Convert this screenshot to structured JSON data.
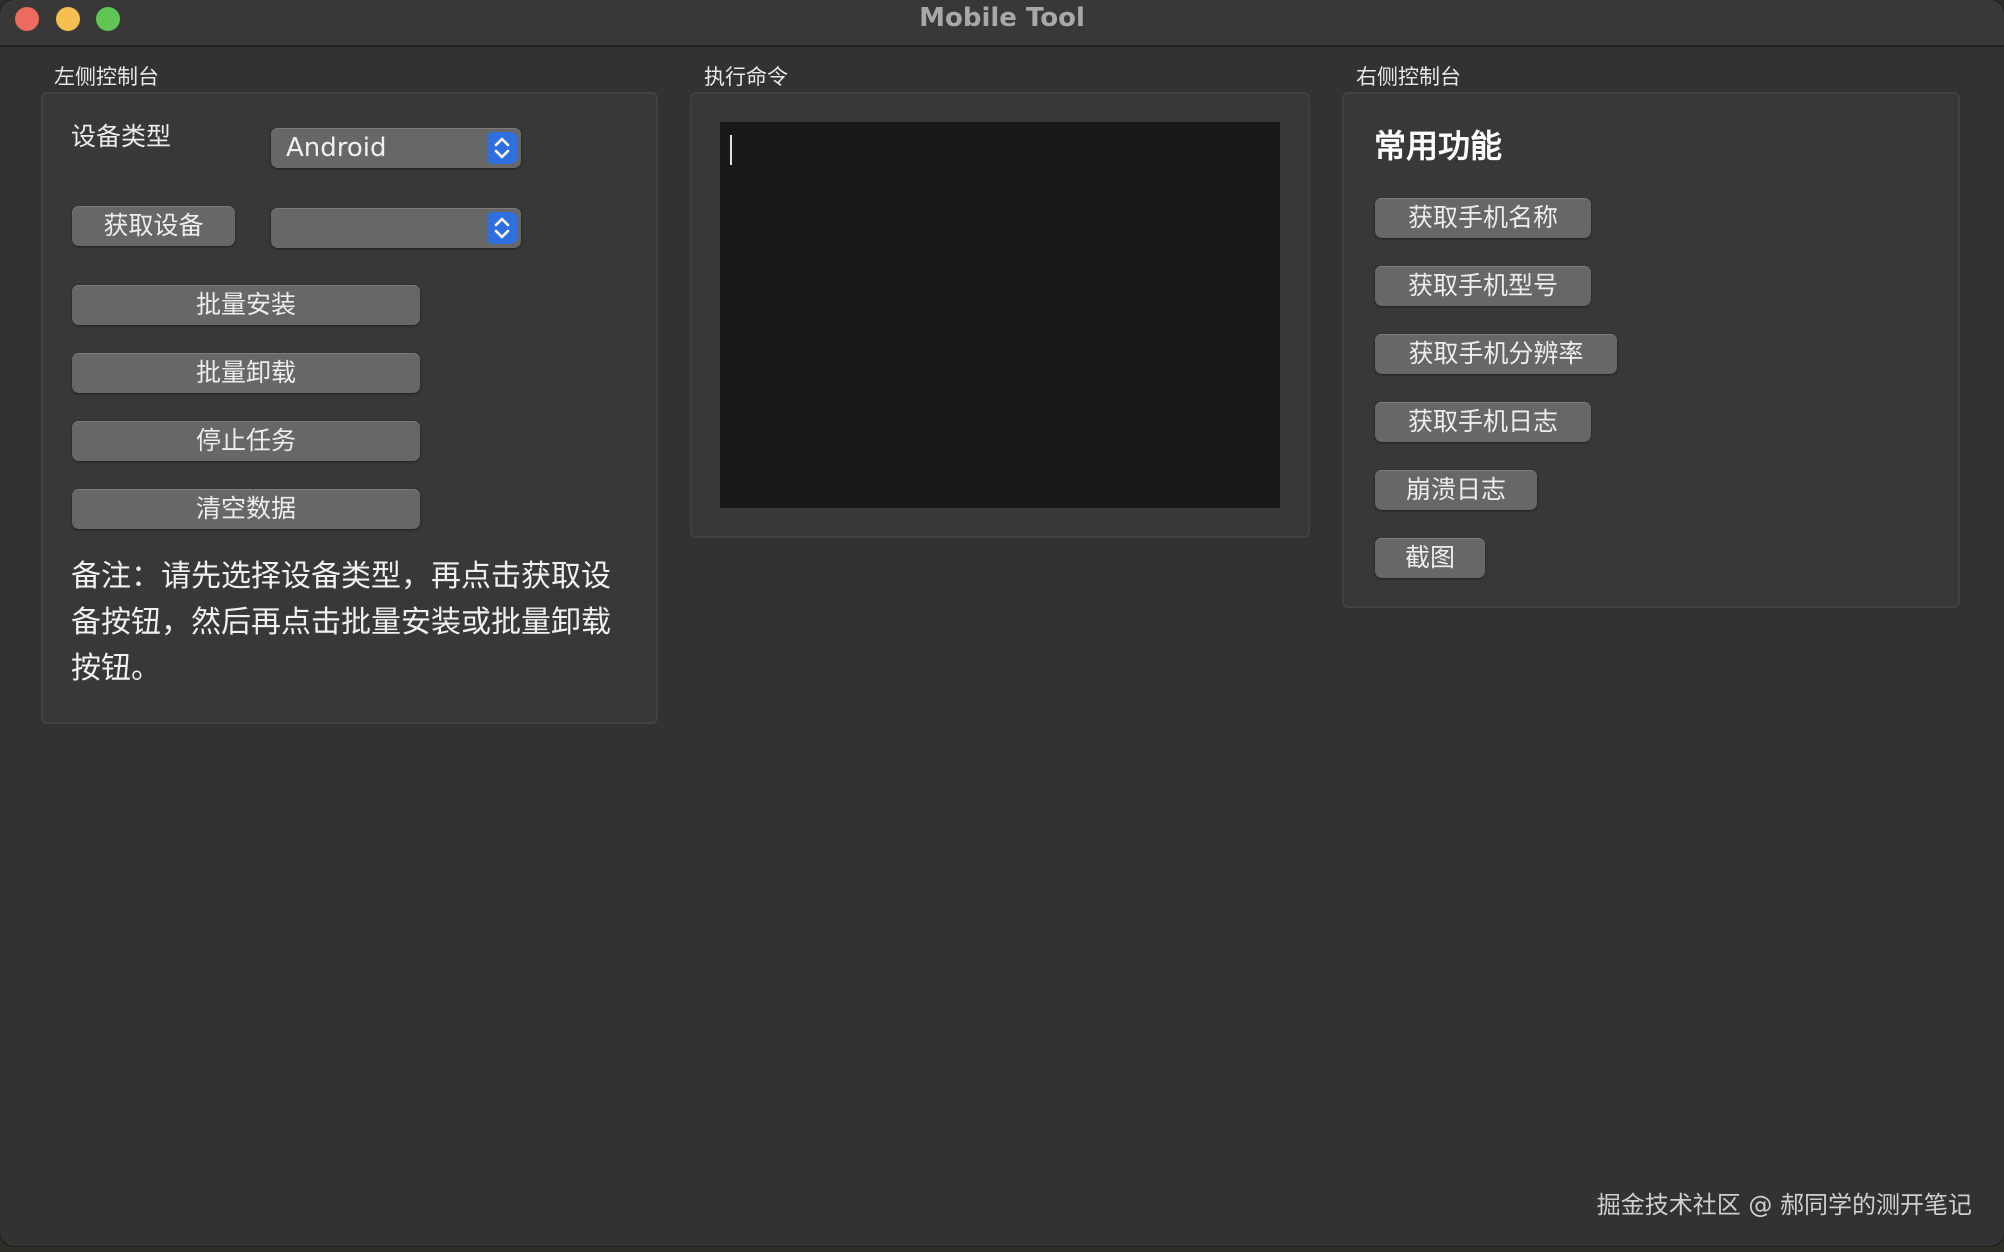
{
  "window": {
    "title": "Mobile Tool"
  },
  "left_panel": {
    "group_label": "左侧控制台",
    "device_type_label": "设备类型",
    "device_type_value": "Android",
    "get_device_button": "获取设备",
    "device_select_value": "",
    "batch_install_button": "批量安装",
    "batch_uninstall_button": "批量卸载",
    "stop_task_button": "停止任务",
    "clear_data_button": "清空数据",
    "note": "备注：请先选择设备类型，再点击获取设备按钮，然后再点击批量安装或批量卸载按钮。"
  },
  "middle_panel": {
    "group_label": "执行命令",
    "console_text": ""
  },
  "right_panel": {
    "group_label": "右侧控制台",
    "section_title": "常用功能",
    "buttons": [
      "获取手机名称",
      "获取手机型号",
      "获取手机分辨率",
      "获取手机日志",
      "崩溃日志",
      "截图"
    ]
  },
  "watermark": "掘金技术社区 @ 郝同学的测开笔记",
  "icons": {
    "select_arrows": "chevron-up-down-icon"
  },
  "colors": {
    "accent": "#2f6fe0",
    "window_bg": "#323232",
    "panel_bg": "#383838",
    "button_bg": "#676767",
    "console_bg": "#181818"
  }
}
